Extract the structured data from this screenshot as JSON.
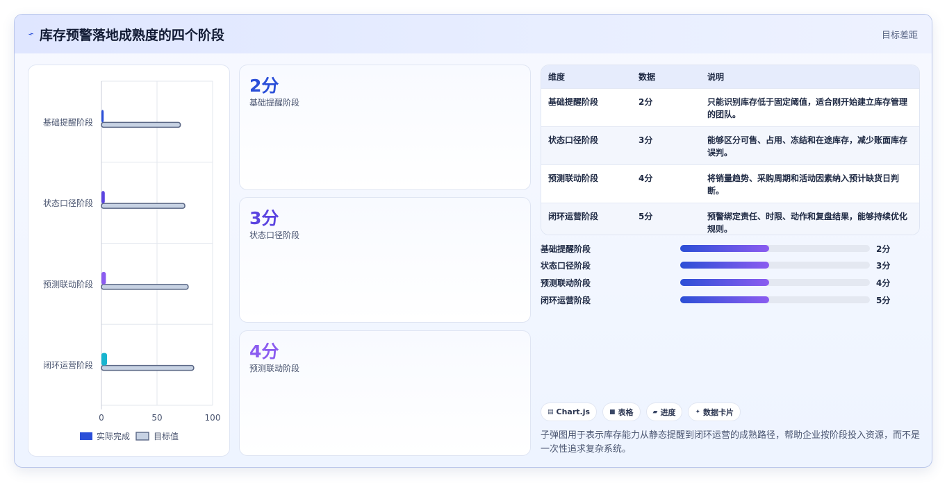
{
  "header": {
    "title": "库存预警落地成熟度的四个阶段",
    "title_icon": "pulse-icon",
    "right_text": "目标差距"
  },
  "chart_data": {
    "type": "bar",
    "orientation": "horizontal",
    "categories": [
      "基础提醒阶段",
      "状态口径阶段",
      "预测联动阶段",
      "闭环运营阶段"
    ],
    "series": [
      {
        "name": "实际完成",
        "values": [
          2,
          3,
          4,
          5
        ],
        "colors": [
          "#2b4fd8",
          "#5b44e0",
          "#8b5cf0",
          "#17b4cf"
        ]
      },
      {
        "name": "目标值",
        "values": [
          71,
          75,
          78,
          83
        ],
        "color": "#c7d2e3",
        "border": "#5a6785"
      }
    ],
    "xlim": [
      0,
      100
    ],
    "xticks": [
      "0",
      "50",
      "100"
    ],
    "grid": true,
    "legend": "bottom"
  },
  "cards": [
    {
      "score": "2分",
      "label": "基础提醒阶段",
      "color": "#2b4fd8"
    },
    {
      "score": "3分",
      "label": "状态口径阶段",
      "color": "#5b44e0"
    },
    {
      "score": "4分",
      "label": "预测联动阶段",
      "color": "#8b5cf0"
    }
  ],
  "table": {
    "headers": [
      "维度",
      "数据",
      "说明"
    ],
    "rows": [
      {
        "dim": "基础提醒阶段",
        "val": "2分",
        "desc": "只能识别库存低于固定阈值，适合刚开始建立库存管理的团队。"
      },
      {
        "dim": "状态口径阶段",
        "val": "3分",
        "desc": "能够区分可售、占用、冻结和在途库存，减少账面库存误判。"
      },
      {
        "dim": "预测联动阶段",
        "val": "4分",
        "desc": "将销量趋势、采购周期和活动因素纳入预计缺货日判断。"
      },
      {
        "dim": "闭环运营阶段",
        "val": "5分",
        "desc": "预警绑定责任、时限、动作和复盘结果，能够持续优化规则。"
      }
    ]
  },
  "progress": [
    {
      "label": "基础提醒阶段",
      "value_text": "2分",
      "fill_fraction": 0.47
    },
    {
      "label": "状态口径阶段",
      "value_text": "3分",
      "fill_fraction": 0.47
    },
    {
      "label": "预测联动阶段",
      "value_text": "4分",
      "fill_fraction": 0.47
    },
    {
      "label": "闭环运营阶段",
      "value_text": "5分",
      "fill_fraction": 0.47
    }
  ],
  "chips": [
    {
      "icon": "chart-icon",
      "label": "Chart.js"
    },
    {
      "icon": "table-icon",
      "label": "表格"
    },
    {
      "icon": "progress-icon",
      "label": "进度"
    },
    {
      "icon": "sparkle-icon",
      "label": "数据卡片"
    }
  ],
  "description": "子弹图用于表示库存能力从静态提醒到闭环运营的成熟路径，帮助企业按阶段投入资源，而不是一次性追求复杂系统。"
}
